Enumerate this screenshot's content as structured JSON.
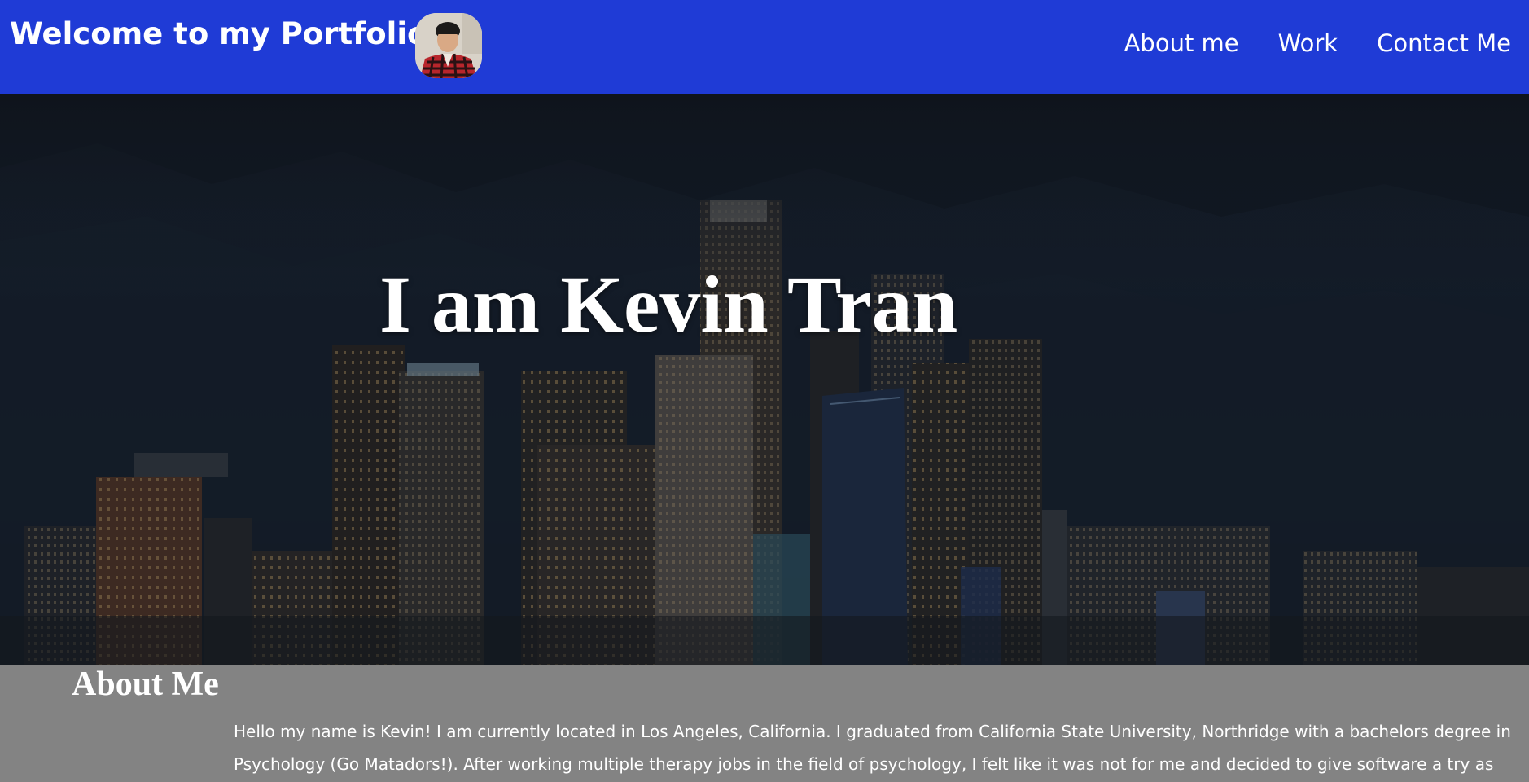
{
  "header": {
    "title": "Welcome to my Portfolio",
    "color": "#1f3bd6",
    "nav": [
      {
        "label": "About me"
      },
      {
        "label": "Work"
      },
      {
        "label": "Contact Me"
      }
    ]
  },
  "hero": {
    "heading": "I am Kevin Tran"
  },
  "about": {
    "title": "About Me",
    "text": "Hello my name is Kevin! I am currently located in Los Angeles, California. I graduated from California State University, Northridge with a bachelors degree in Psychology (Go Matadors!). After working multiple therapy jobs in the field of psychology, I felt like it was not for me and decided to give software a try as computer science was my original",
    "background": "#838383"
  }
}
